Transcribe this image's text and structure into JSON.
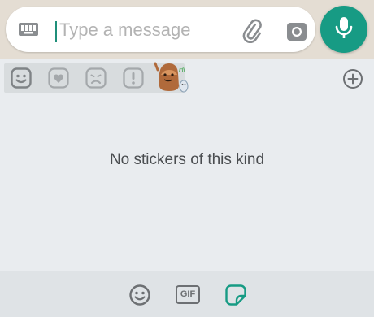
{
  "composer": {
    "placeholder": "Type a message",
    "value": ""
  },
  "sticker_tray": {
    "tabs": [
      {
        "name": "emoji",
        "icon": "smiley-face-icon",
        "selected": true
      },
      {
        "name": "love",
        "icon": "heart-icon"
      },
      {
        "name": "sad",
        "icon": "sad-face-icon"
      },
      {
        "name": "fun",
        "icon": "exclamation-icon"
      },
      {
        "name": "pack",
        "icon": "sticker-pack-thumbnail"
      }
    ],
    "add_icon": "plus-circle-icon",
    "empty_message": "No stickers of this kind"
  },
  "bottom_bar": {
    "gif_label": "GIF",
    "items": [
      "emoji-icon",
      "gif-icon",
      "sticker-icon"
    ],
    "selected": "sticker-icon"
  },
  "colors": {
    "accent": "#179b84",
    "cursor": "#1f8f7a",
    "tray_background": "#e9ecef",
    "bottom_bar_background": "#dfe3e6"
  }
}
